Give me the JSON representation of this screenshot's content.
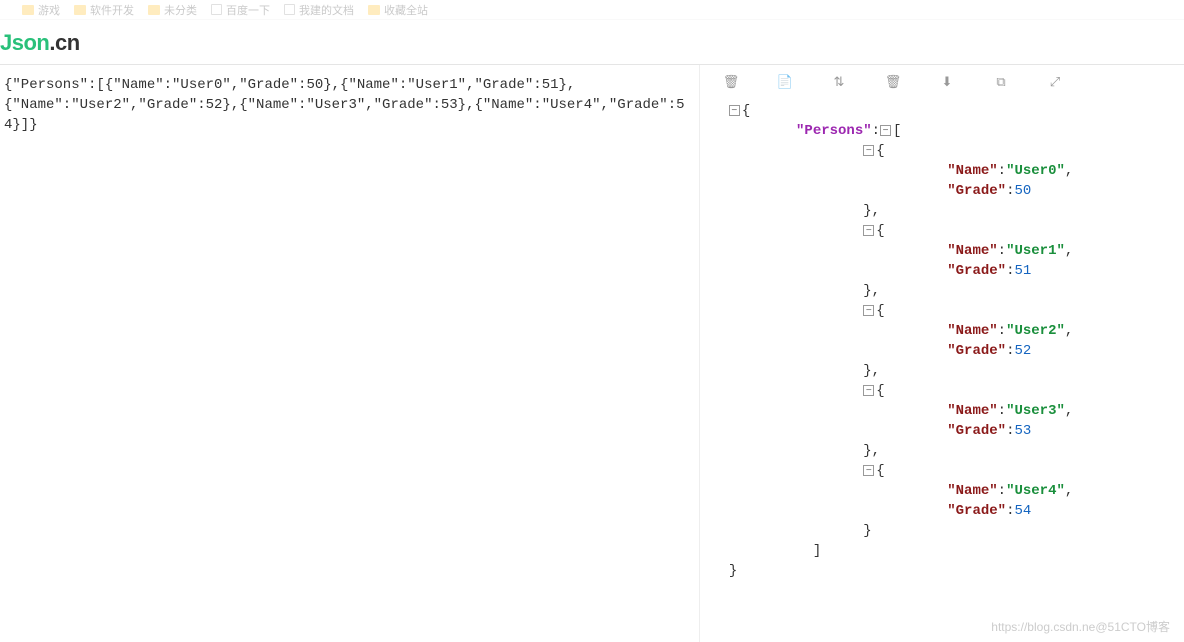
{
  "bookmarks": [
    {
      "type": "folder",
      "label": "游戏"
    },
    {
      "type": "folder",
      "label": "软件开发"
    },
    {
      "type": "folder",
      "label": "未分类"
    },
    {
      "type": "page",
      "label": "百度一下"
    },
    {
      "type": "page",
      "label": "我建的文档"
    },
    {
      "type": "folder",
      "label": "收藏全站"
    }
  ],
  "logo": {
    "part1": "Json",
    "part2": ".cn"
  },
  "raw_json_lines": [
    "{\"Persons\":[{\"Name\":\"User0\",\"Grade\":50},{\"Name\":\"User1\",\"Grade\":51},",
    "{\"Name\":\"User2\",\"Grade\":52},{\"Name\":\"User3\",\"Grade\":53},{\"Name\":\"User4\",\"Grade\":54}]}"
  ],
  "toolbar_icons": [
    {
      "name": "clear",
      "glyph": "🗑"
    },
    {
      "name": "copy",
      "glyph": "📄"
    },
    {
      "name": "sort",
      "glyph": "⇅"
    },
    {
      "name": "delete",
      "glyph": "🗑"
    },
    {
      "name": "download",
      "glyph": "⬇"
    },
    {
      "name": "duplicate",
      "glyph": "⧉"
    },
    {
      "name": "collapse",
      "glyph": "⤢"
    }
  ],
  "tree": {
    "root_key": "\"Persons\"",
    "toggle_glyph": "−",
    "persons": [
      {
        "Name": "\"User0\"",
        "Grade": "50"
      },
      {
        "Name": "\"User1\"",
        "Grade": "51"
      },
      {
        "Name": "\"User2\"",
        "Grade": "52"
      },
      {
        "Name": "\"User3\"",
        "Grade": "53"
      },
      {
        "Name": "\"User4\"",
        "Grade": "54"
      }
    ],
    "key_name": "\"Name\"",
    "key_grade": "\"Grade\""
  },
  "watermark": "https://blog.csdn.ne@51CTO博客"
}
